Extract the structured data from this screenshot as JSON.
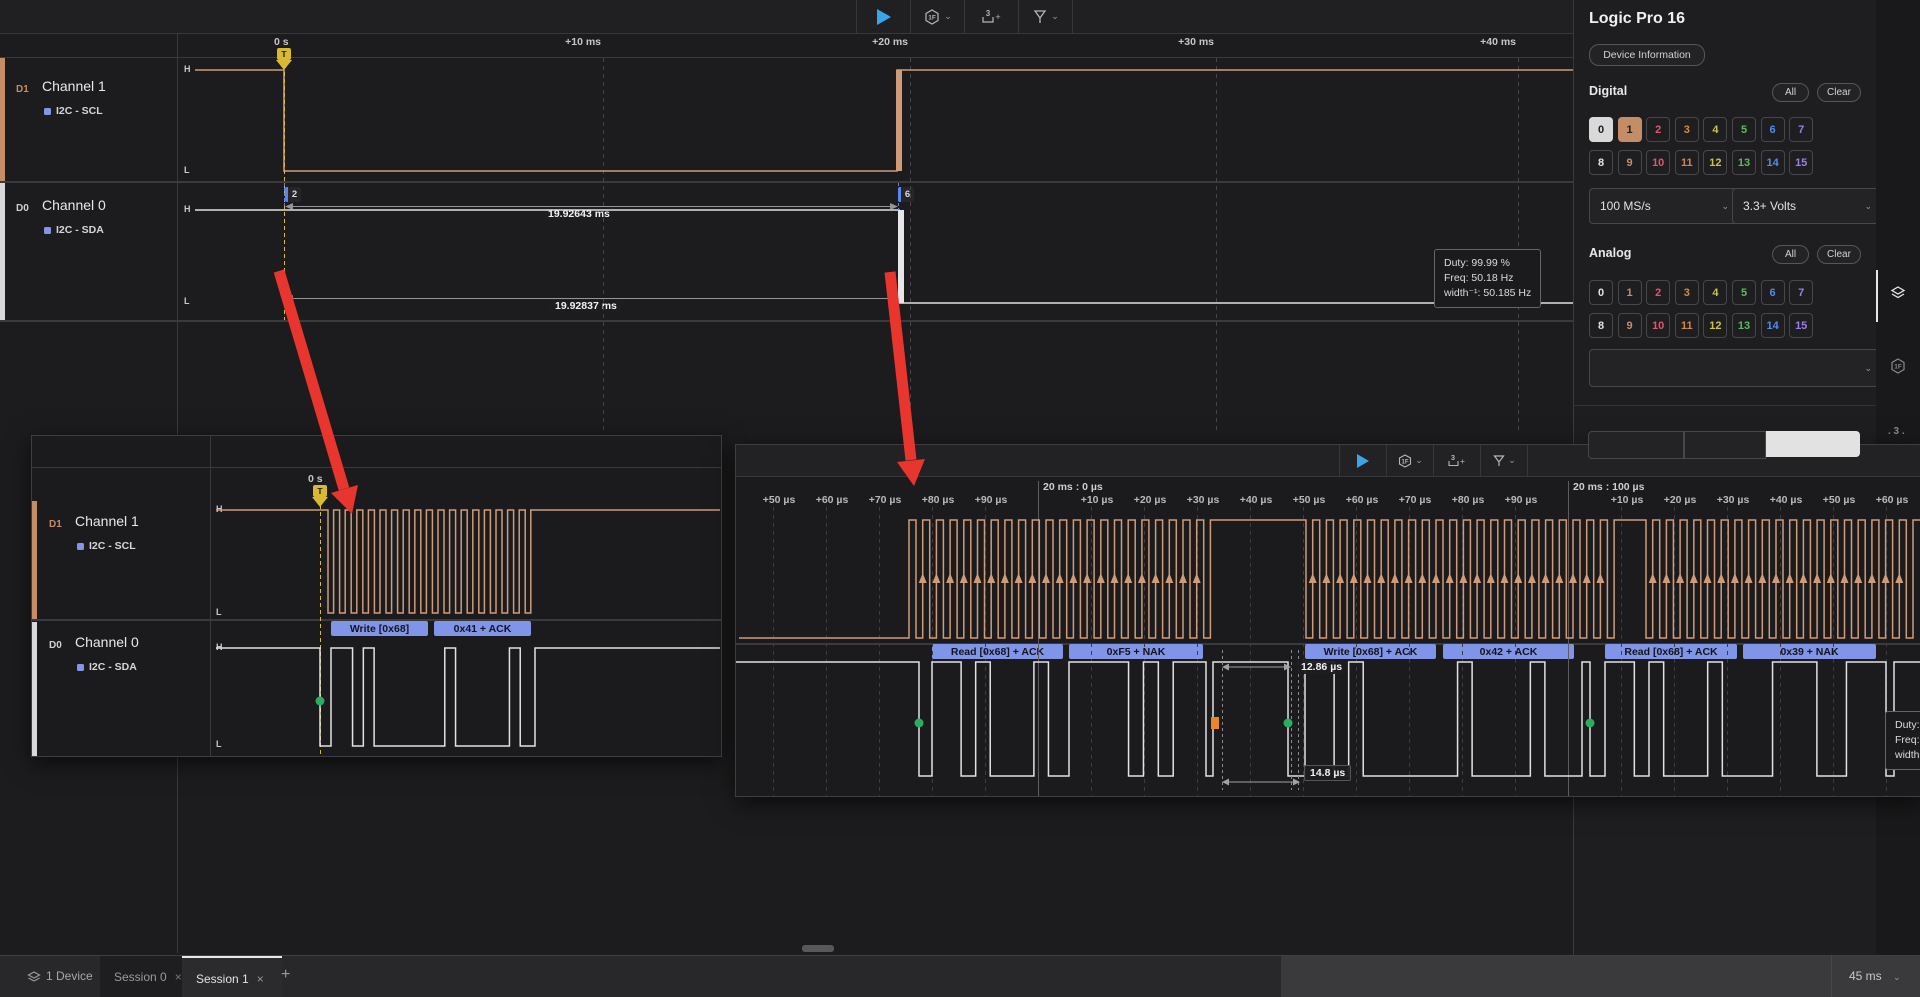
{
  "toolbar": {
    "play_icon": "play",
    "capture_icon": "1F",
    "measure_icon": "3",
    "measure_plus": "+",
    "trigger_icon": "trigger-flag"
  },
  "ruler": {
    "labels": [
      "0 s",
      "+10 ms",
      "+20 ms",
      "+30 ms",
      "+40 ms"
    ]
  },
  "trigger_marker": "T",
  "levels": {
    "high": "H",
    "low": "L"
  },
  "channels": [
    {
      "id": "D1",
      "name": "Channel 1",
      "analyzer": "I2C - SCL",
      "color": "#c58d66"
    },
    {
      "id": "D0",
      "name": "Channel 0",
      "analyzer": "I2C - SDA",
      "color": "#d8d8d8"
    }
  ],
  "markers": [
    "2",
    "6"
  ],
  "measurements": {
    "top": "19.92643 ms",
    "bottom": "19.92837 ms"
  },
  "tooltip": {
    "duty": "Duty: 99.99 %",
    "freq": "Freq: 50.18 Hz",
    "width": "width⁻¹: 50.185 Hz"
  },
  "sidebar": {
    "title": "Logic Pro 16",
    "device_info": "Device Information",
    "digital": {
      "label": "Digital",
      "all": "All",
      "clear": "Clear"
    },
    "analog": {
      "label": "Analog",
      "all": "All",
      "clear": "Clear"
    },
    "channel_numbers": [
      0,
      1,
      2,
      3,
      4,
      5,
      6,
      7,
      8,
      9,
      10,
      11,
      12,
      13,
      14,
      15
    ],
    "channel_colors": [
      "#e2e2e2",
      "#c58d66",
      "#e05570",
      "#cf8a4b",
      "#cdc34b",
      "#5dba5d",
      "#4f8fe8",
      "#9d7fe0"
    ],
    "digital_selected": [
      0,
      1
    ],
    "sample_rate": "100 MS/s",
    "voltage": "3.3+ Volts"
  },
  "inset_left": {
    "ruler_label": "0 s",
    "trigger_marker": "T",
    "channels": [
      {
        "id": "D1",
        "name": "Channel 1",
        "analyzer": "I2C - SCL"
      },
      {
        "id": "D0",
        "name": "Channel 0",
        "analyzer": "I2C - SDA"
      }
    ],
    "decoders": [
      {
        "label": "Write [0x68]",
        "bits": [
          1,
          1,
          0,
          1,
          0,
          0,
          0,
          0,
          0
        ]
      },
      {
        "label": "0x41 + ACK",
        "bits": [
          0,
          1,
          0,
          0,
          0,
          0,
          0,
          1,
          0
        ]
      }
    ]
  },
  "inset_right": {
    "ticks": [
      {
        "t": "+50 µs"
      },
      {
        "t": "+60 µs"
      },
      {
        "t": "+70 µs"
      },
      {
        "t": "+80 µs"
      },
      {
        "t": "+90 µs"
      },
      {
        "t": "20 ms : 0 µs",
        "major": true
      },
      {
        "t": "+10 µs"
      },
      {
        "t": "+20 µs"
      },
      {
        "t": "+30 µs"
      },
      {
        "t": "+40 µs"
      },
      {
        "t": "+50 µs"
      },
      {
        "t": "+60 µs"
      },
      {
        "t": "+70 µs"
      },
      {
        "t": "+80 µs"
      },
      {
        "t": "+90 µs"
      },
      {
        "t": "20 ms : 100 µs",
        "major": true
      },
      {
        "t": "+10 µs"
      },
      {
        "t": "+20 µs"
      },
      {
        "t": "+30 µs"
      },
      {
        "t": "+40 µs"
      },
      {
        "t": "+50 µs"
      },
      {
        "t": "+60 µs"
      }
    ],
    "decoders": [
      {
        "label": "Read [0x68] + ACK",
        "bits": [
          1,
          1,
          0,
          1,
          0,
          0,
          0,
          1,
          0
        ]
      },
      {
        "label": "0xF5 + NAK",
        "bits": [
          1,
          1,
          1,
          1,
          0,
          1,
          0,
          1,
          1
        ]
      },
      {
        "label": "Write [0x68] + ACK",
        "bits": [
          1,
          1,
          0,
          1,
          0,
          0,
          0,
          0,
          0
        ]
      },
      {
        "label": "0x42 + ACK",
        "bits": [
          0,
          1,
          0,
          0,
          0,
          0,
          1,
          0,
          0
        ]
      },
      {
        "label": "Read [0x68] + ACK",
        "bits": [
          1,
          1,
          0,
          1,
          0,
          0,
          0,
          1,
          0
        ]
      },
      {
        "label": "0x39 + NAK",
        "bits": [
          0,
          0,
          1,
          1,
          1,
          0,
          0,
          1,
          1
        ]
      }
    ],
    "measure_top": "12.86 µs",
    "measure_bottom": "14.8 µs",
    "tooltip_fragment": [
      "Duty:",
      "Freq:",
      "width"
    ]
  },
  "tabbar": {
    "device": "1 Device",
    "sessions": [
      "Session 0",
      "Session 1"
    ],
    "active_index": 1,
    "close": "×",
    "new_tab": "+",
    "range": "45 ms"
  }
}
